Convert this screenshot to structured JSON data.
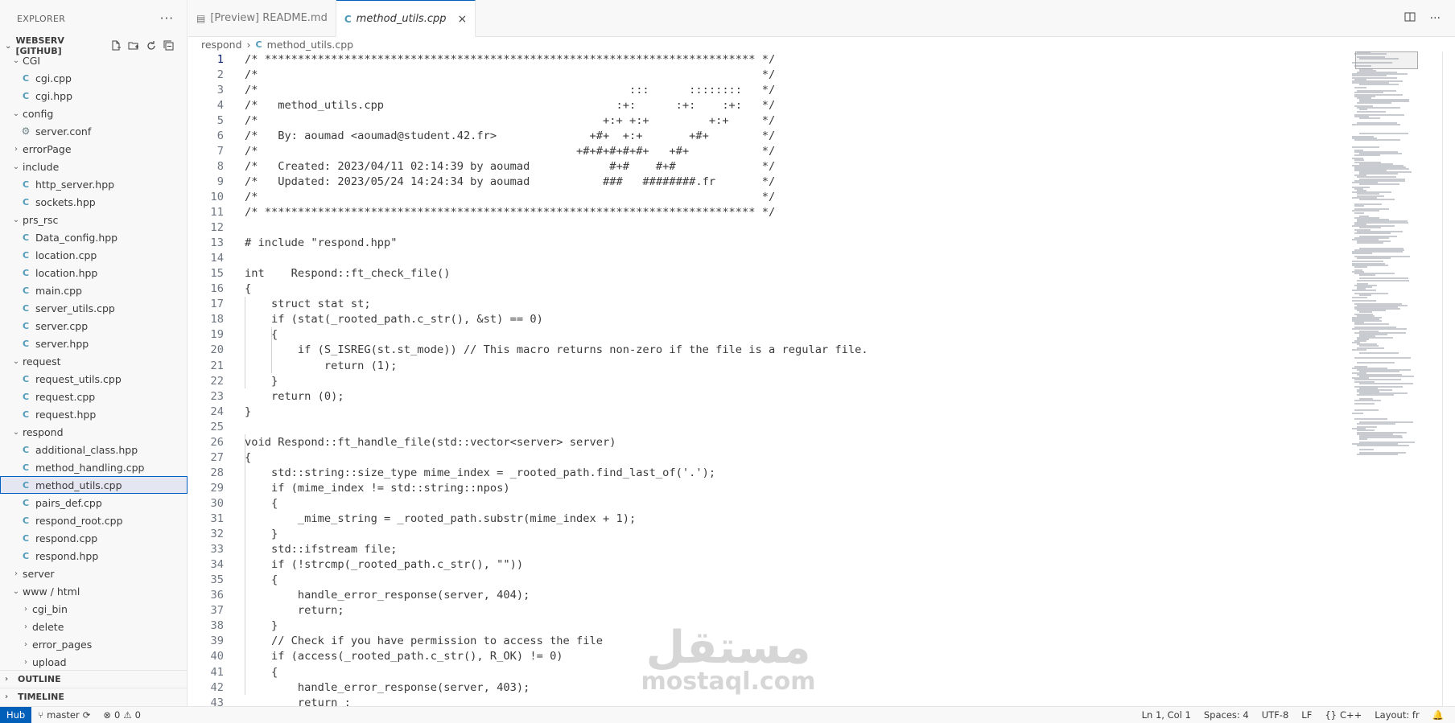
{
  "sidebar": {
    "title": "EXPLORER",
    "more_icon": "ellipsis-icon",
    "workspace": "WEBSERV [GITHUB]",
    "tree": [
      {
        "label": "CGI",
        "type": "folder",
        "open": true,
        "depth": 1
      },
      {
        "label": "cgi.cpp",
        "type": "cpp",
        "depth": 2
      },
      {
        "label": "cgi.hpp",
        "type": "cpp",
        "depth": 2
      },
      {
        "label": "config",
        "type": "folder",
        "open": true,
        "depth": 1
      },
      {
        "label": "server.conf",
        "type": "gear",
        "depth": 2
      },
      {
        "label": "errorPage",
        "type": "folder",
        "open": false,
        "depth": 1
      },
      {
        "label": "include",
        "type": "folder",
        "open": true,
        "depth": 1
      },
      {
        "label": "http_server.hpp",
        "type": "cpp",
        "depth": 2
      },
      {
        "label": "sockets.hpp",
        "type": "cpp",
        "depth": 2
      },
      {
        "label": "prs_rsc",
        "type": "folder",
        "open": true,
        "depth": 1
      },
      {
        "label": "Data_config.hpp",
        "type": "cpp",
        "depth": 2
      },
      {
        "label": "location.cpp",
        "type": "cpp",
        "depth": 2
      },
      {
        "label": "location.hpp",
        "type": "cpp",
        "depth": 2
      },
      {
        "label": "main.cpp",
        "type": "cpp",
        "depth": 2
      },
      {
        "label": "server_utils.cpp",
        "type": "cpp",
        "depth": 2
      },
      {
        "label": "server.cpp",
        "type": "cpp",
        "depth": 2
      },
      {
        "label": "server.hpp",
        "type": "cpp",
        "depth": 2
      },
      {
        "label": "request",
        "type": "folder",
        "open": true,
        "depth": 1
      },
      {
        "label": "request_utils.cpp",
        "type": "cpp",
        "depth": 2
      },
      {
        "label": "request.cpp",
        "type": "cpp",
        "depth": 2
      },
      {
        "label": "request.hpp",
        "type": "cpp",
        "depth": 2
      },
      {
        "label": "respond",
        "type": "folder",
        "open": true,
        "depth": 1
      },
      {
        "label": "additional_class.hpp",
        "type": "cpp",
        "depth": 2
      },
      {
        "label": "method_handling.cpp",
        "type": "cpp",
        "depth": 2
      },
      {
        "label": "method_utils.cpp",
        "type": "cpp",
        "depth": 2,
        "selected": true
      },
      {
        "label": "pairs_def.cpp",
        "type": "cpp",
        "depth": 2
      },
      {
        "label": "respond_root.cpp",
        "type": "cpp",
        "depth": 2
      },
      {
        "label": "respond.cpp",
        "type": "cpp",
        "depth": 2
      },
      {
        "label": "respond.hpp",
        "type": "cpp",
        "depth": 2
      },
      {
        "label": "server",
        "type": "folder",
        "open": false,
        "depth": 1
      },
      {
        "label": "www / html",
        "type": "folder",
        "open": true,
        "depth": 1
      },
      {
        "label": "cgi_bin",
        "type": "folder",
        "open": false,
        "depth": 2
      },
      {
        "label": "delete",
        "type": "folder",
        "open": false,
        "depth": 2
      },
      {
        "label": "error_pages",
        "type": "folder",
        "open": false,
        "depth": 2
      },
      {
        "label": "upload",
        "type": "folder",
        "open": false,
        "depth": 2
      }
    ],
    "outline": "OUTLINE",
    "timeline": "TIMELINE"
  },
  "tabs": [
    {
      "label": "[Preview] README.md",
      "icon": "preview-icon",
      "active": false
    },
    {
      "label": "method_utils.cpp",
      "icon": "cpp-file-icon",
      "active": true
    }
  ],
  "breadcrumb": {
    "folder": "respond",
    "file": "method_utils.cpp"
  },
  "editor": {
    "current_line": 1,
    "lines": [
      "/* ************************************************************************** */",
      "/*                                                                            */",
      "/*                                                        :::      ::::::::   */",
      "/*   method_utils.cpp                                   :+:      :+:    :+:   */",
      "/*                                                    +:+ +:+         +:+     */",
      "/*   By: aoumad <aoumad@student.42.fr>              +#+  +:+       +#+        */",
      "/*                                                +#+#+#+#+#+   +#+           */",
      "/*   Created: 2023/04/11 02:14:39 by aoumad            #+#    #+#             */",
      "/*   Updated: 2023/05/24 14:24:34 by aoumad           ###   ########.fr       */",
      "/*                                                                            */",
      "/* ************************************************************************** */",
      "",
      "# include \"respond.hpp\"",
      "",
      "int    Respond::ft_check_file()",
      "{",
      "    struct stat st;",
      "    if (stat(_rooted_path.c_str(), &st) == 0)",
      "    {",
      "        if (S_ISREG(st.st_mode)) // This macro returns non-zero if the file is a regular file.",
      "            return (1);",
      "    }",
      "    return (0);",
      "}",
      "",
      "void Respond::ft_handle_file(std::vector<server> server)",
      "{",
      "    std::string::size_type mime_index = _rooted_path.find_last_of('.');",
      "    if (mime_index != std::string::npos)",
      "    {",
      "        _mime_string = _rooted_path.substr(mime_index + 1);",
      "    }",
      "    std::ifstream file;",
      "    if (!strcmp(_rooted_path.c_str(), \"\"))",
      "    {",
      "        handle_error_response(server, 404);",
      "        return;",
      "    }",
      "    // Check if you have permission to access the file",
      "    if (access(_rooted_path.c_str(), R_OK) != 0)",
      "    {",
      "        handle_error_response(server, 403);",
      "        return ;"
    ]
  },
  "watermark": {
    "arabic": "مستقل",
    "latin": "mostaql.com"
  },
  "statusbar": {
    "remote": "Hub",
    "branch": "master",
    "errors": "0",
    "warnings": "0",
    "position": "Ln 1, Col 1",
    "spaces": "Spaces: 4",
    "encoding": "UTF-8",
    "eol": "LF",
    "language": "C++",
    "layout": "Layout: fr"
  }
}
